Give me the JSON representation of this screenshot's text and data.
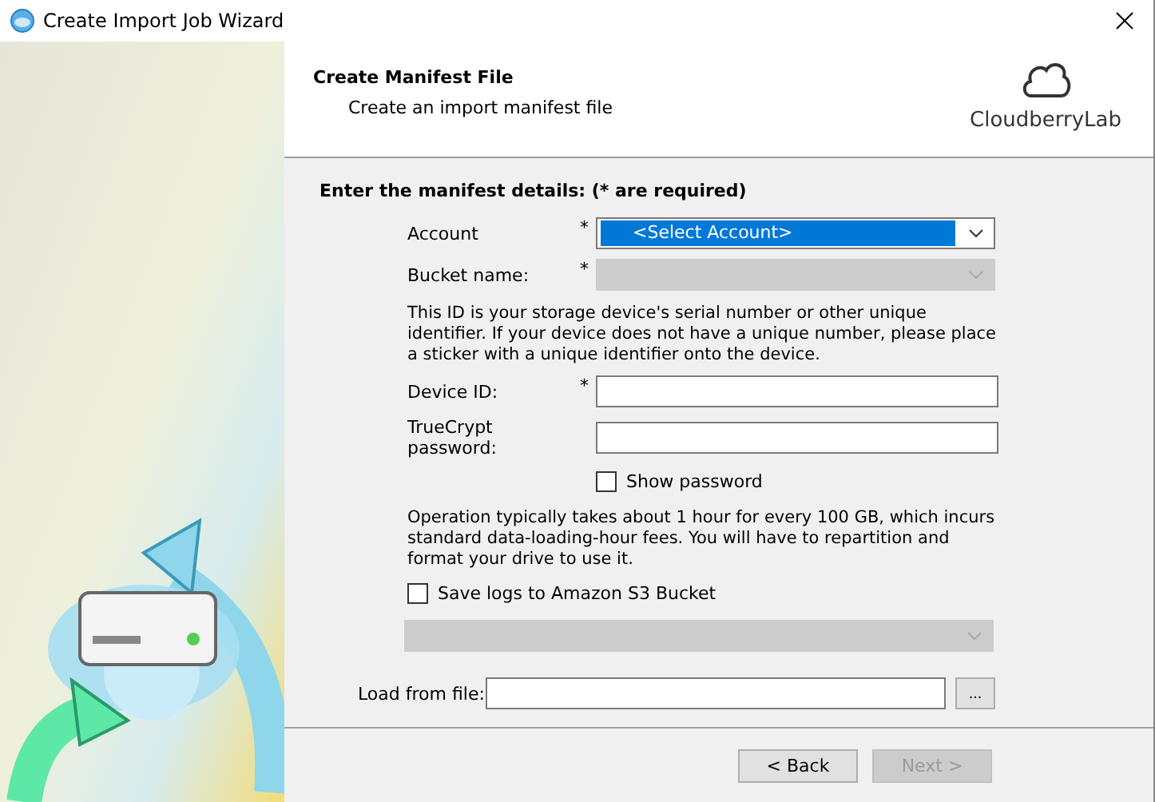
{
  "window": {
    "title": "Create Import Job Wizard"
  },
  "header": {
    "title": "Create Manifest File",
    "subtitle": "Create an import manifest file",
    "logo_text": "CloudberryLab"
  },
  "form": {
    "heading": "Enter the manifest details: (* are required)",
    "account": {
      "label": "Account",
      "required": "*",
      "value": "<Select Account>",
      "disabled": false
    },
    "bucket": {
      "label": "Bucket name:",
      "required": "*",
      "disabled": true
    },
    "device_note": "This ID is your storage device's serial number or other unique identifier. If your device does not have a unique number, please place a sticker with a unique identifier onto the device.",
    "device_id": {
      "label": "Device ID:",
      "required": "*"
    },
    "truecrypt": {
      "label": "TrueCrypt password:"
    },
    "show_password": {
      "label": "Show password",
      "checked": false
    },
    "operation_note": "Operation typically takes about 1 hour for every 100 GB, which incurs standard data-loading-hour fees. You will have to repartition and format your drive to use it.",
    "save_logs": {
      "label": "Save logs to Amazon S3 Bucket",
      "checked": false
    },
    "logs_bucket": {
      "disabled": true
    },
    "load_from_file": {
      "label": "Load from file:",
      "browse": "..."
    }
  },
  "buttons": [
    {
      "label": "< Back",
      "disabled": false
    },
    {
      "label": "Next >",
      "disabled": true
    }
  ]
}
